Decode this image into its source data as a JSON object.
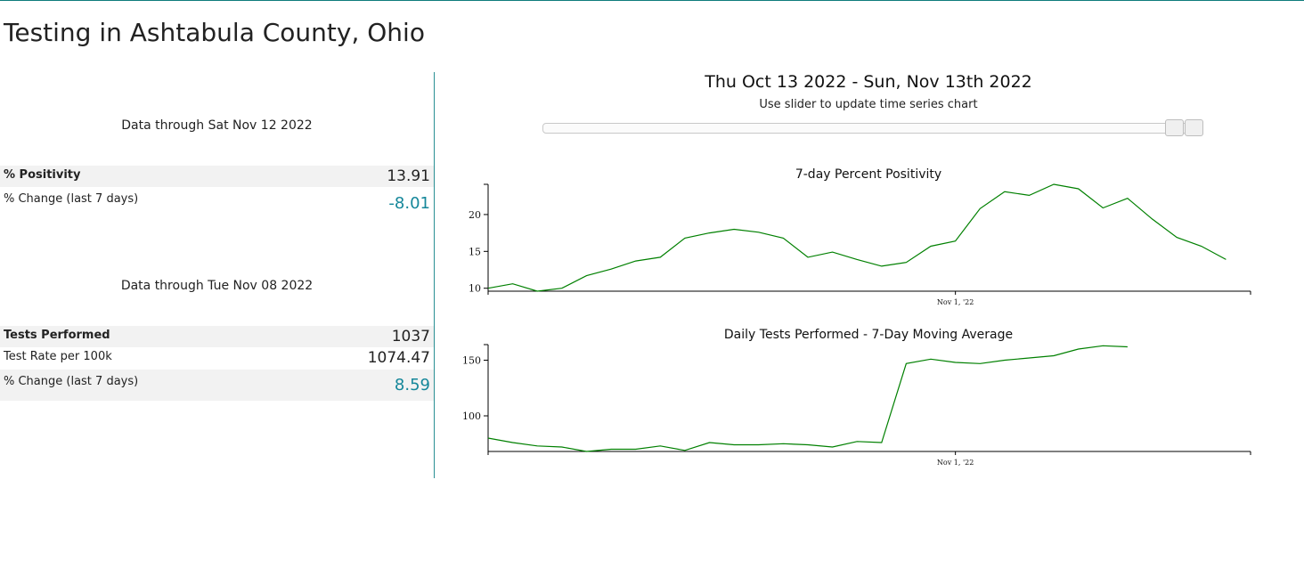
{
  "page_title": "Testing in Ashtabula County, Ohio",
  "positivity_section": {
    "header": "Data through Sat Nov 12 2022",
    "rows": [
      {
        "label": "% Positivity",
        "value": "13.91"
      },
      {
        "label": "% Change (last 7 days)",
        "value": "-8.01"
      }
    ]
  },
  "tests_section": {
    "header": "Data through Tue Nov 08 2022",
    "rows": [
      {
        "label": "Tests Performed",
        "value": "1037"
      },
      {
        "label": "Test Rate per 100k",
        "value": "1074.47"
      },
      {
        "label": "% Change (last 7 days)",
        "value": "8.59"
      }
    ]
  },
  "date_range": "Thu Oct 13 2022 - Sun, Nov 13th 2022",
  "slider": {
    "hint": "Use slider to update time series chart",
    "range_start": "2022-10-13",
    "range_end": "2022-11-13"
  },
  "colors": {
    "accent": "#15879a",
    "divider": "#2a8f93",
    "line": "#008000",
    "shaded_row": "#f2f2f2"
  },
  "chart_data": [
    {
      "type": "line",
      "title": "7-day Percent Positivity",
      "xlabel": "",
      "ylabel": "",
      "x_ticks": [
        {
          "date": "2022-11-01",
          "label": "Nov 1, '22"
        }
      ],
      "y_ticks": [
        10,
        15,
        20
      ],
      "ylim": [
        9.6,
        24.1
      ],
      "xlim": [
        "2022-10-13",
        "2022-11-13"
      ],
      "grid": false,
      "series": [
        {
          "x": [
            "2022-10-13",
            "2022-10-14",
            "2022-10-15",
            "2022-10-16",
            "2022-10-17",
            "2022-10-18",
            "2022-10-19",
            "2022-10-20",
            "2022-10-21",
            "2022-10-22",
            "2022-10-23",
            "2022-10-24",
            "2022-10-25",
            "2022-10-26",
            "2022-10-27",
            "2022-10-28",
            "2022-10-29",
            "2022-10-30",
            "2022-10-31",
            "2022-11-01",
            "2022-11-02",
            "2022-11-03",
            "2022-11-04",
            "2022-11-05",
            "2022-11-06",
            "2022-11-07",
            "2022-11-08",
            "2022-11-09",
            "2022-11-10",
            "2022-11-11",
            "2022-11-12"
          ],
          "values": [
            10.0,
            10.6,
            9.6,
            10.0,
            11.7,
            12.6,
            13.7,
            14.2,
            16.8,
            17.5,
            18.0,
            17.6,
            16.8,
            14.2,
            14.9,
            13.9,
            13.0,
            13.5,
            15.7,
            16.4,
            20.8,
            23.1,
            22.6,
            24.1,
            23.5,
            20.9,
            22.2,
            19.4,
            16.9,
            15.7,
            13.9
          ]
        }
      ]
    },
    {
      "type": "line",
      "title": "Daily Tests Performed - 7-Day Moving Average",
      "xlabel": "",
      "ylabel": "",
      "x_ticks": [
        {
          "date": "2022-11-01",
          "label": "Nov 1, '22"
        }
      ],
      "y_ticks": [
        100,
        150
      ],
      "ylim": [
        68,
        164
      ],
      "xlim": [
        "2022-10-13",
        "2022-11-13"
      ],
      "grid": false,
      "series": [
        {
          "x": [
            "2022-10-13",
            "2022-10-14",
            "2022-10-15",
            "2022-10-16",
            "2022-10-17",
            "2022-10-18",
            "2022-10-19",
            "2022-10-20",
            "2022-10-21",
            "2022-10-22",
            "2022-10-23",
            "2022-10-24",
            "2022-10-25",
            "2022-10-26",
            "2022-10-27",
            "2022-10-28",
            "2022-10-29",
            "2022-10-30",
            "2022-10-31",
            "2022-11-01",
            "2022-11-02",
            "2022-11-03",
            "2022-11-04",
            "2022-11-05",
            "2022-11-06",
            "2022-11-07",
            "2022-11-08"
          ],
          "values": [
            80,
            76,
            73,
            72,
            68,
            70,
            70,
            73,
            69,
            76,
            74,
            74,
            75,
            74,
            72,
            77,
            76,
            147,
            151,
            148,
            147,
            150,
            152,
            154,
            160,
            163,
            162
          ]
        }
      ]
    }
  ]
}
